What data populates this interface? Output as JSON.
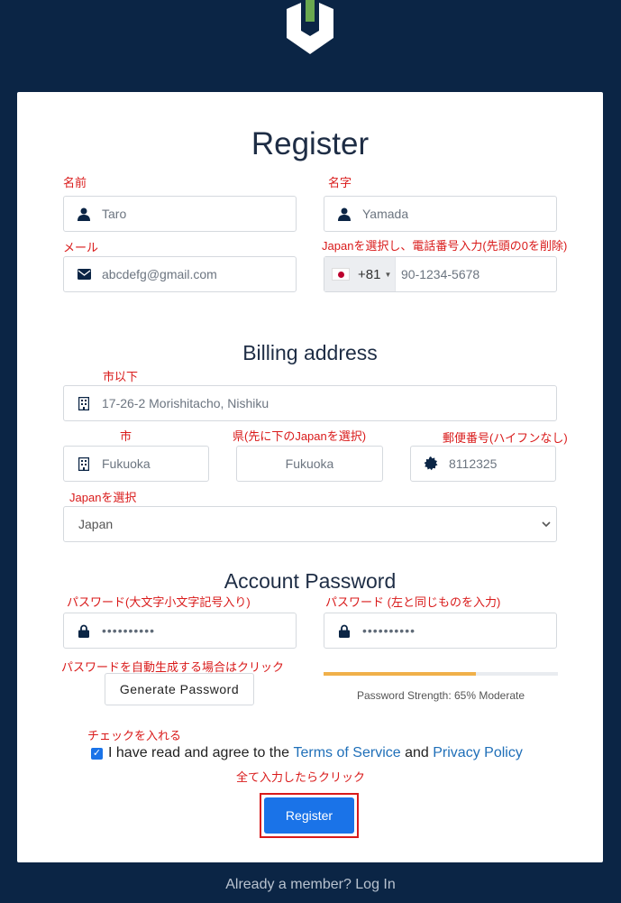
{
  "title": "Register",
  "notes": {
    "first_name": "名前",
    "last_name": "名字",
    "email": "メール",
    "phone": "Japanを選択し、電話番号入力(先頭の0を削除)",
    "street": "市以下",
    "city": "市",
    "state": "県(先に下のJapanを選択)",
    "postcode": "郵便番号(ハイフンなし)",
    "country": "Japanを選択",
    "password": "パスワード(大文字小文字記号入り)",
    "confirm_password": "パスワード (左と同じものを入力)",
    "generate": "パスワードを自動生成する場合はクリック",
    "check": "チェックを入れる",
    "submit": "全て入力したらクリック"
  },
  "fields": {
    "first_name": "Taro",
    "last_name": "Yamada",
    "email": "abcdefg@gmail.com",
    "phone_country_code": "+81",
    "phone_number": "90-1234-5678",
    "street": "17-26-2 Morishitacho, Nishiku",
    "city": "Fukuoka",
    "state": "Fukuoka",
    "postcode": "8112325",
    "country": "Japan",
    "password": "••••••••••",
    "confirm_password": "••••••••••"
  },
  "billing_heading": "Billing address",
  "password_heading": "Account Password",
  "generate_button": "Generate Password",
  "strength": {
    "text": "Password Strength: 65% Moderate",
    "percent": 65
  },
  "agree": {
    "prefix": "I have read and agree to the",
    "terms": "Terms of Service",
    "and": "and",
    "privacy": "Privacy Policy",
    "checked": true
  },
  "register_button": "Register",
  "footer": "Already a member? Log In",
  "colors": {
    "background": "#0b2545",
    "accent": "#1a73e8",
    "annotation": "#d91a1a",
    "logo_top": "#6aa84f",
    "strength": "#f0b04a"
  }
}
